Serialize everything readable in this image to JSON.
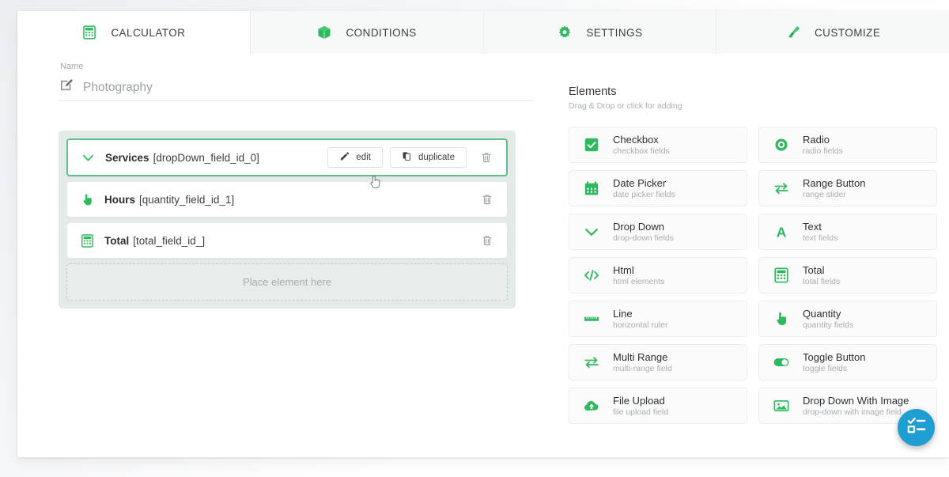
{
  "tabs": [
    {
      "label": "CALCULATOR",
      "icon": "calculator-icon",
      "active": true
    },
    {
      "label": "CONDITIONS",
      "icon": "box-icon",
      "active": false
    },
    {
      "label": "SETTINGS",
      "icon": "gear-icon",
      "active": false
    },
    {
      "label": "CUSTOMIZE",
      "icon": "brush-icon",
      "active": false
    }
  ],
  "name_field": {
    "label": "Name",
    "value": "Photography",
    "placeholder": "Photography",
    "icon": "edit-square-icon"
  },
  "field_list": {
    "rows": [
      {
        "title": "Services",
        "id": "[dropDown_field_id_0]",
        "icon": "chevron-down-icon",
        "selected": true,
        "buttons": [
          {
            "label": "edit",
            "icon": "pencil-icon"
          },
          {
            "label": "duplicate",
            "icon": "copy-icon"
          }
        ],
        "delete_icon": "trash-icon"
      },
      {
        "title": "Hours",
        "id": "[quantity_field_id_1]",
        "icon": "hand-pointer-icon",
        "selected": false,
        "buttons": [],
        "delete_icon": "trash-icon"
      },
      {
        "title": "Total",
        "id": "[total_field_id_]",
        "icon": "calculator-icon",
        "selected": false,
        "buttons": [],
        "delete_icon": "trash-icon"
      }
    ],
    "drop_zone_text": "Place element here"
  },
  "elements_panel": {
    "title": "Elements",
    "subtitle": "Drag & Drop or click for adding",
    "items": [
      {
        "title": "Checkbox",
        "subtitle": "checkbox fields",
        "icon": "checkbox-icon"
      },
      {
        "title": "Radio",
        "subtitle": "radio fields",
        "icon": "radio-icon"
      },
      {
        "title": "Date Picker",
        "subtitle": "date picker fields",
        "icon": "calendar-icon"
      },
      {
        "title": "Range Button",
        "subtitle": "range slider",
        "icon": "exchange-arrows-icon"
      },
      {
        "title": "Drop Down",
        "subtitle": "drop-down fields",
        "icon": "chevron-down-icon"
      },
      {
        "title": "Text",
        "subtitle": "text fields",
        "icon": "letter-a-icon"
      },
      {
        "title": "Html",
        "subtitle": "html elements",
        "icon": "code-icon"
      },
      {
        "title": "Total",
        "subtitle": "total fields",
        "icon": "calculator-icon"
      },
      {
        "title": "Line",
        "subtitle": "horizontal ruler",
        "icon": "ruler-icon"
      },
      {
        "title": "Quantity",
        "subtitle": "quantity fields",
        "icon": "hand-pointer-icon"
      },
      {
        "title": "Multi Range",
        "subtitle": "multi-range field",
        "icon": "exchange-arrows-icon"
      },
      {
        "title": "Toggle Button",
        "subtitle": "toggle fields",
        "icon": "toggle-on-icon"
      },
      {
        "title": "File Upload",
        "subtitle": "file upload field",
        "icon": "cloud-upload-icon"
      },
      {
        "title": "Drop Down With Image",
        "subtitle": "drop-down with image field",
        "icon": "image-icon"
      }
    ]
  },
  "fab": {
    "icon": "checklist-icon"
  },
  "colors": {
    "brand_green": "#2fb95f",
    "accent_green": "#5fbf8d",
    "fab_blue": "#1f9ed2",
    "text_dark": "#2c3034",
    "text_muted": "#a9aeb1",
    "panel_bg": "#e4eae8"
  }
}
